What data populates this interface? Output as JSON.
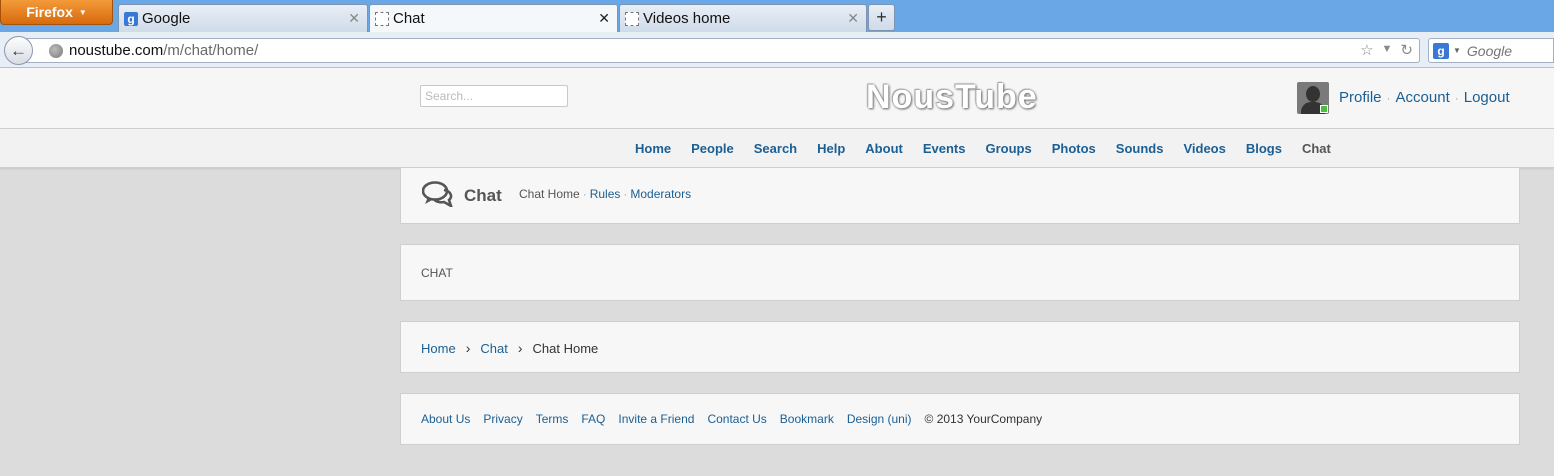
{
  "browser": {
    "app_button": "Firefox",
    "tabs": [
      {
        "title": "Google"
      },
      {
        "title": "Chat"
      },
      {
        "title": "Videos home"
      }
    ],
    "new_tab": "+",
    "url_host": "noustube.com",
    "url_path": "/m/chat/home/",
    "search_placeholder": "Google"
  },
  "site": {
    "search_placeholder": "Search...",
    "logo": "NousTube",
    "user_links": [
      "Profile",
      "Account",
      "Logout"
    ],
    "menu": [
      "Home",
      "People",
      "Search",
      "Help",
      "About",
      "Events",
      "Groups",
      "Photos",
      "Sounds",
      "Videos",
      "Blogs",
      "Chat"
    ],
    "page_title": "Chat",
    "submenu": [
      "Chat Home",
      "Rules",
      "Moderators"
    ],
    "content_text": "CHAT",
    "breadcrumbs": [
      "Home",
      "Chat",
      "Chat Home"
    ],
    "footer_links": [
      "About Us",
      "Privacy",
      "Terms",
      "FAQ",
      "Invite a Friend",
      "Contact Us",
      "Bookmark",
      "Design (uni)"
    ],
    "copyright": "© 2013 YourCompany",
    "separator": "›"
  }
}
